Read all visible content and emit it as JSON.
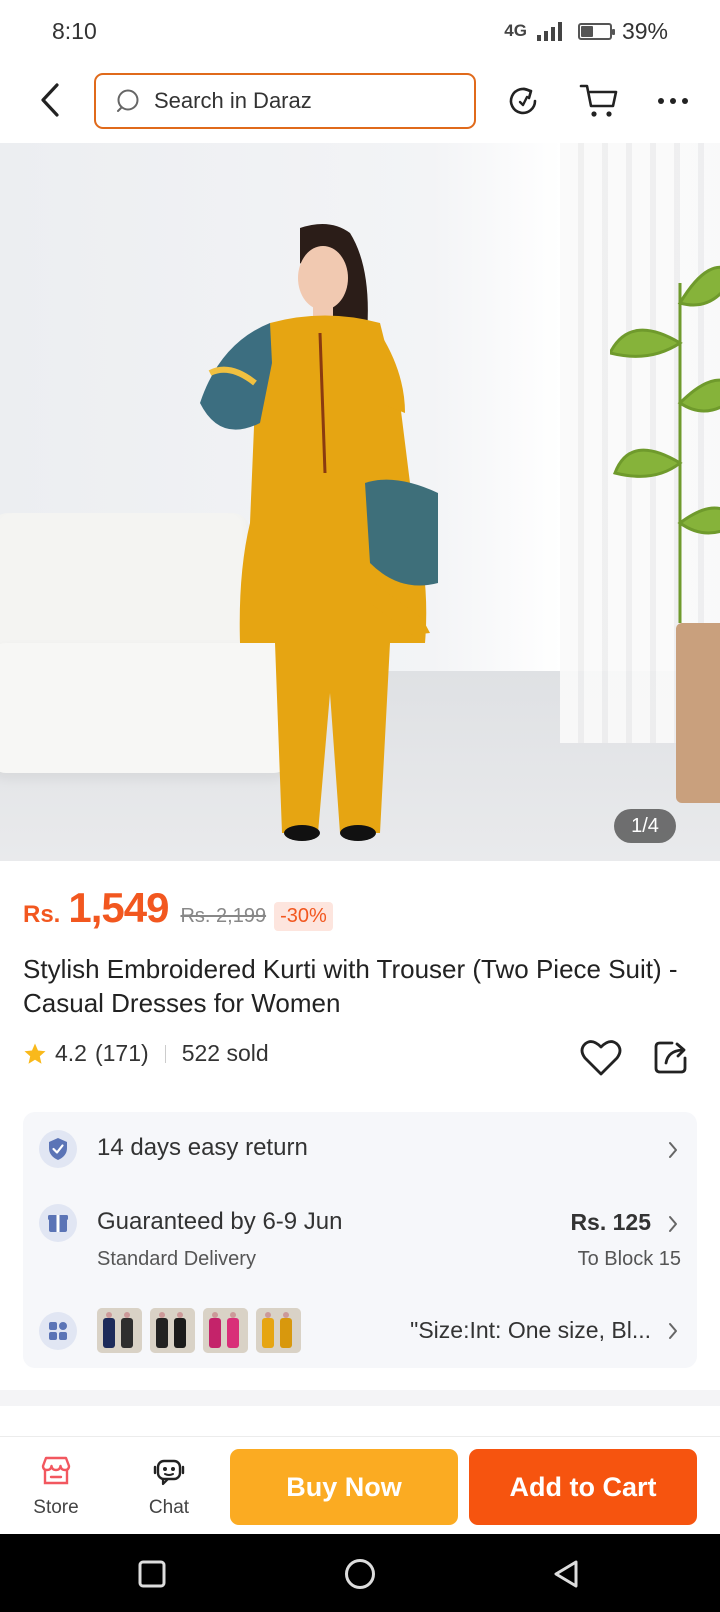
{
  "status_bar": {
    "time": "8:10",
    "network": "4G",
    "battery": "39%",
    "battery_level": 0.39
  },
  "search": {
    "placeholder": "Search in Daraz"
  },
  "gallery": {
    "counter": "1/4"
  },
  "price": {
    "currency": "Rs.",
    "current": "1,549",
    "original": "Rs. 2,199",
    "discount": "-30%"
  },
  "product": {
    "title": "Stylish Embroidered Kurti with Trouser (Two Piece Suit) - Casual Dresses for Women"
  },
  "rating": {
    "score": "4.2",
    "count": "(171)",
    "sold": "522 sold"
  },
  "services": {
    "return": "14 days easy return",
    "delivery": {
      "title": "Guaranteed by 6-9 Jun",
      "method": "Standard Delivery",
      "price": "Rs. 125",
      "destination": "To Block 15"
    },
    "variant": {
      "text": "\"Size:Int: One size, Bl..."
    }
  },
  "action_bar": {
    "store": "Store",
    "chat": "Chat",
    "buy_now": "Buy Now",
    "add_to_cart": "Add to Cart"
  },
  "colors": {
    "accent": "#f6540f",
    "buy_now": "#fbab22",
    "search_border": "#e06a1b",
    "price": "#f2571f"
  }
}
